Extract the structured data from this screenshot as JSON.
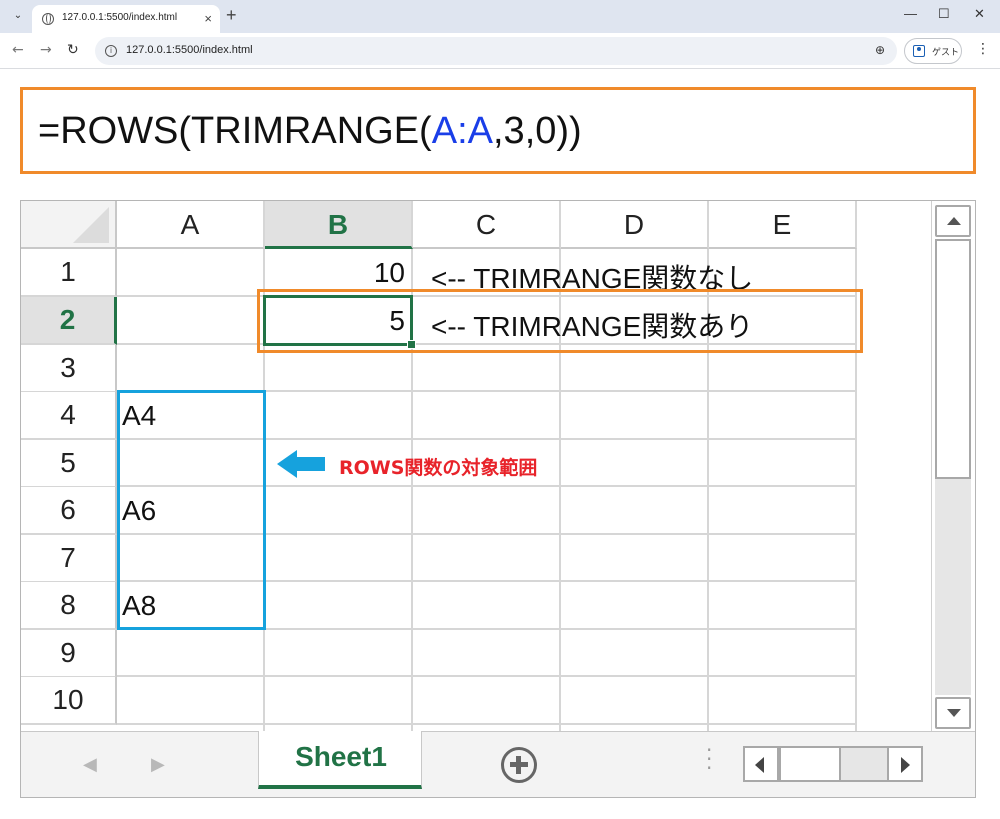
{
  "browser": {
    "tab_title": "127.0.0.1:5500/index.html",
    "url": "127.0.0.1:5500/index.html",
    "profile_label": "ゲスト",
    "new_tab_label": "+",
    "close_tab_label": "×",
    "minimize_label": "—",
    "maximize_label": "☐",
    "close_window_label": "✕"
  },
  "formula": {
    "prefix": "=ROWS(TRIMRANGE(",
    "range_start": "A",
    "range_colon": ":",
    "range_end": "A",
    "suffix": ",3,0))",
    "range_color": "#1a3ee8"
  },
  "spreadsheet": {
    "columns": [
      "A",
      "B",
      "C",
      "D",
      "E"
    ],
    "selected_column": "B",
    "rows": [
      "1",
      "2",
      "3",
      "4",
      "5",
      "6",
      "7",
      "8",
      "9",
      "10"
    ],
    "selected_row": "2",
    "cells": {
      "B1": "10",
      "C1": "<-- TRIMRANGE関数なし",
      "B2": "5",
      "C2": "<-- TRIMRANGE関数あり",
      "A4": "A4",
      "A6": "A6",
      "A8": "A8"
    },
    "active_cell": "B2",
    "accent_color": "#217346"
  },
  "annotations": {
    "range_label": "ROWS関数の対象範囲",
    "label_color": "#e8232a",
    "highlight_orange": "#f08a2a",
    "highlight_blue": "#16a2dd"
  },
  "sheet_tabs": {
    "active": "Sheet1"
  }
}
